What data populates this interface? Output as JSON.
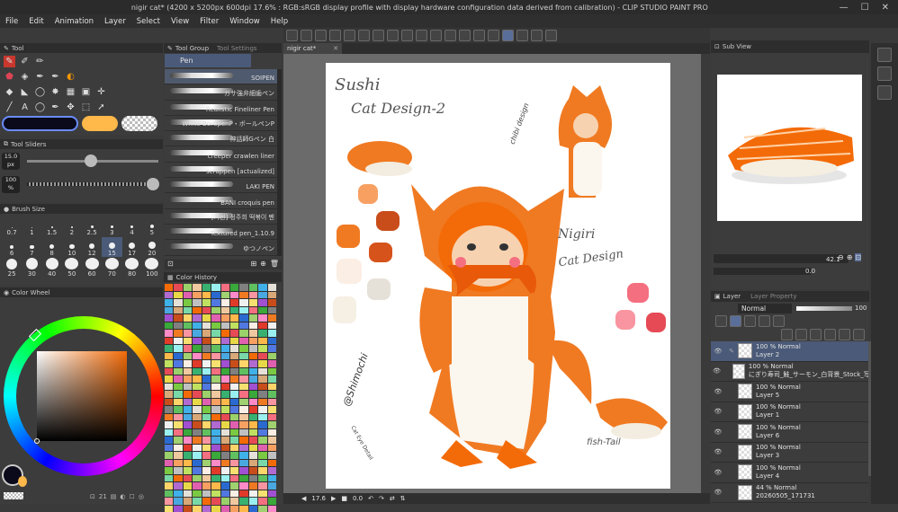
{
  "window": {
    "title": "nigir cat* (4200 x 5200px 600dpi 17.6% : RGB:sRGB display profile with display hardware configuration data derived from calibration)  - CLIP STUDIO PAINT PRO"
  },
  "menu": [
    "File",
    "Edit",
    "Animation",
    "Layer",
    "Select",
    "View",
    "Filter",
    "Window",
    "Help"
  ],
  "panels": {
    "tool": "Tool",
    "tool_group": "Tool Group",
    "tool_settings": "Tool Settings",
    "pen_tab": "Pen",
    "tool_sliders": "Tool Sliders",
    "brush_size": "Brush Size",
    "color_wheel": "Color Wheel",
    "color_history": "Color History",
    "sub_view": "Sub View",
    "layer": "Layer",
    "layer_property": "Layer Property"
  },
  "sliders": {
    "size_value": "15.0",
    "size_unit": "px",
    "opacity_value": "100",
    "opacity_unit": "%"
  },
  "brushes": [
    "SOIPEN",
    "ガサ強弁細歯ペン",
    "Realistic Fineliner Pen",
    "White BorupenP・ボールペンP",
    "神話師Gペン 白",
    "creeper crawlen liner",
    "scrappen [actualized]",
    "LAKI PEN",
    "BANI croquis pen",
    "[기선] 정주희 떡볶이 펜",
    "Textured pen_1.10.9",
    "ゆつノペン"
  ],
  "brush_sizes": [
    {
      "v": "0.7",
      "d": 1
    },
    {
      "v": "1",
      "d": 1.5
    },
    {
      "v": "1.5",
      "d": 2
    },
    {
      "v": "2",
      "d": 2.5
    },
    {
      "v": "2.5",
      "d": 3
    },
    {
      "v": "3",
      "d": 3
    },
    {
      "v": "4",
      "d": 3.5
    },
    {
      "v": "5",
      "d": 4
    },
    {
      "v": "6",
      "d": 4
    },
    {
      "v": "7",
      "d": 4.5
    },
    {
      "v": "8",
      "d": 5
    },
    {
      "v": "10",
      "d": 5.5
    },
    {
      "v": "12",
      "d": 6
    },
    {
      "v": "15",
      "d": 7,
      "sel": true
    },
    {
      "v": "17",
      "d": 7.5
    },
    {
      "v": "20",
      "d": 8
    },
    {
      "v": "25",
      "d": 12
    },
    {
      "v": "30",
      "d": 13
    },
    {
      "v": "40",
      "d": 14
    },
    {
      "v": "50",
      "d": 15
    },
    {
      "v": "60",
      "d": 15
    },
    {
      "v": "70",
      "d": 15
    },
    {
      "v": "80",
      "d": 15
    },
    {
      "v": "100",
      "d": 15
    }
  ],
  "canvas": {
    "tab": "nigir cat*",
    "zoom": "17.6",
    "angle": "0.0"
  },
  "art_text": {
    "title1": "Sushi",
    "title2": "Cat Design-2",
    "chibi": "chibi design",
    "nigiri1": "Nigiri",
    "nigiri2": "Cat Design",
    "sig": "@Shimochi",
    "fish": "fish-Tail",
    "eye": "Cat Eye Detail"
  },
  "subview": {
    "zoom": "42.1",
    "angle": "0.0"
  },
  "layer_panel": {
    "blend": "Normal",
    "opacity": "100"
  },
  "layers": [
    {
      "opacity": "100 % Normal",
      "name": "Layer 2",
      "selected": true
    },
    {
      "opacity": "100 % Normal",
      "name": "にぎり寿司_鮭_サーモン_白背景_Stock_写真 letter"
    },
    {
      "opacity": "100 % Normal",
      "name": "Layer 5"
    },
    {
      "opacity": "100 % Normal",
      "name": "Layer 1"
    },
    {
      "opacity": "100 % Normal",
      "name": "Layer 6"
    },
    {
      "opacity": "100 % Normal",
      "name": "Layer 3"
    },
    {
      "opacity": "100 % Normal",
      "name": "Layer 4"
    },
    {
      "opacity": "44 % Normal",
      "name": "20260505_171731"
    }
  ],
  "status": {
    "memory": "21"
  },
  "colors": {
    "main": "#0a0a1a",
    "sub": "#ffb84a",
    "accent": "#6a8cff"
  }
}
